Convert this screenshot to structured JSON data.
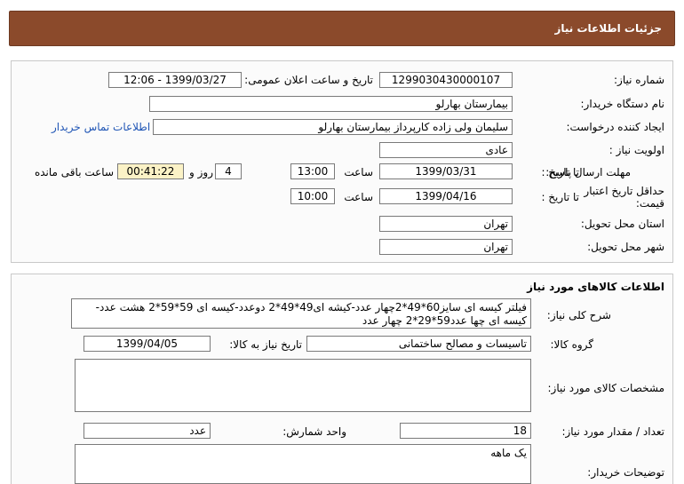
{
  "header": {
    "title": "جزئیات اطلاعات نیاز"
  },
  "info": {
    "need_number_label": "شماره نیاز:",
    "need_number": "1299030430000107",
    "announce_label": "تاریخ و ساعت اعلان عمومی:",
    "announce_value": "1399/03/27 - 12:06",
    "buyer_org_label": "نام دستگاه خریدار:",
    "buyer_org": "بیمارستان بهارلو",
    "creator_label": "ایجاد کننده درخواست:",
    "creator": "سلیمان  ولی زاده  کارپرداز بیمارستان بهارلو",
    "contact_link": "اطلاعات تماس خریدار",
    "priority_label": "اولویت نیاز :",
    "priority": "عادی",
    "deadline_label": "مهلت ارسال پاسخ:",
    "to_date_label": "تا تاریخ :",
    "deadline_date": "1399/03/31",
    "time_label": "ساعت",
    "deadline_time": "13:00",
    "days_value": "4",
    "days_label": "روز و",
    "remaining_time": "00:41:22",
    "remaining_label": "ساعت باقی مانده",
    "min_validity_label": "حداقل تاریخ اعتبار قیمت:",
    "validity_to_label": "تا تاریخ :",
    "validity_date": "1399/04/16",
    "validity_time_label": "ساعت",
    "validity_time": "10:00",
    "province_label": "استان محل تحویل:",
    "province": "تهران",
    "city_label": "شهر محل تحویل:",
    "city": "تهران"
  },
  "goods": {
    "section_title": "اطلاعات کالاهای مورد نیاز",
    "desc_label": "شرح کلی نیاز:",
    "desc_line1": "فیلتر کیسه ای سایز60*49*2چهار عدد-کیشه ای49*49*2 دوعدد-کیسه ای 59*59*2 هشت عدد-",
    "desc_line2": "کیسه ای چها عدد59*29*2 چهار عدد",
    "group_label": "گروه کالا:",
    "group_value": "تاسیسات و مصالح ساختمانی",
    "need_date_label": "تاریخ نیاز به کالا:",
    "need_date": "1399/04/05",
    "specs_label": "مشخصات کالای مورد نیاز:",
    "specs_value": "",
    "qty_label": "تعداد / مقدار مورد نیاز:",
    "qty_value": "18",
    "unit_label": "واحد شمارش:",
    "unit_value": "عدد",
    "buyer_notes_label": "توضیحات خریدار:",
    "buyer_notes": "یک ماهه"
  }
}
